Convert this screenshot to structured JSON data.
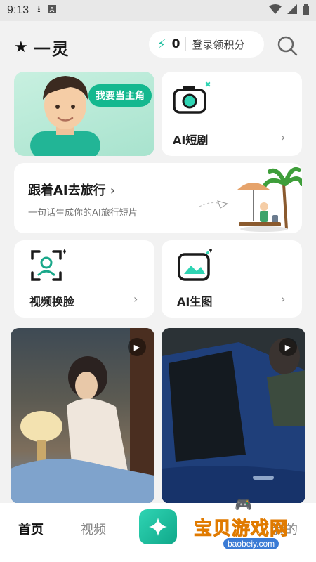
{
  "status_bar": {
    "time": "9:13",
    "icons": [
      "download-icon",
      "a-box-icon"
    ],
    "right_icons": [
      "wifi-icon",
      "signal-icon",
      "battery-icon"
    ]
  },
  "header": {
    "app_name": "一灵",
    "points_count": "0",
    "login_label": "登录领积分"
  },
  "hero": {
    "pill_label": "我要当主角"
  },
  "features": {
    "ai_short_drama": "AI短剧",
    "video_face_swap": "视频换脸",
    "ai_image": "AI生图"
  },
  "travel": {
    "title": "跟着AI去旅行",
    "subtitle": "一句话生成你的AI旅行短片"
  },
  "tabs": {
    "home": "首页",
    "video": "视频",
    "mine": "我的"
  },
  "watermark": {
    "title": "宝贝游戏网",
    "url": "baobeiy.com"
  },
  "colors": {
    "accent": "#14b88f",
    "background": "#f2f2f2"
  }
}
